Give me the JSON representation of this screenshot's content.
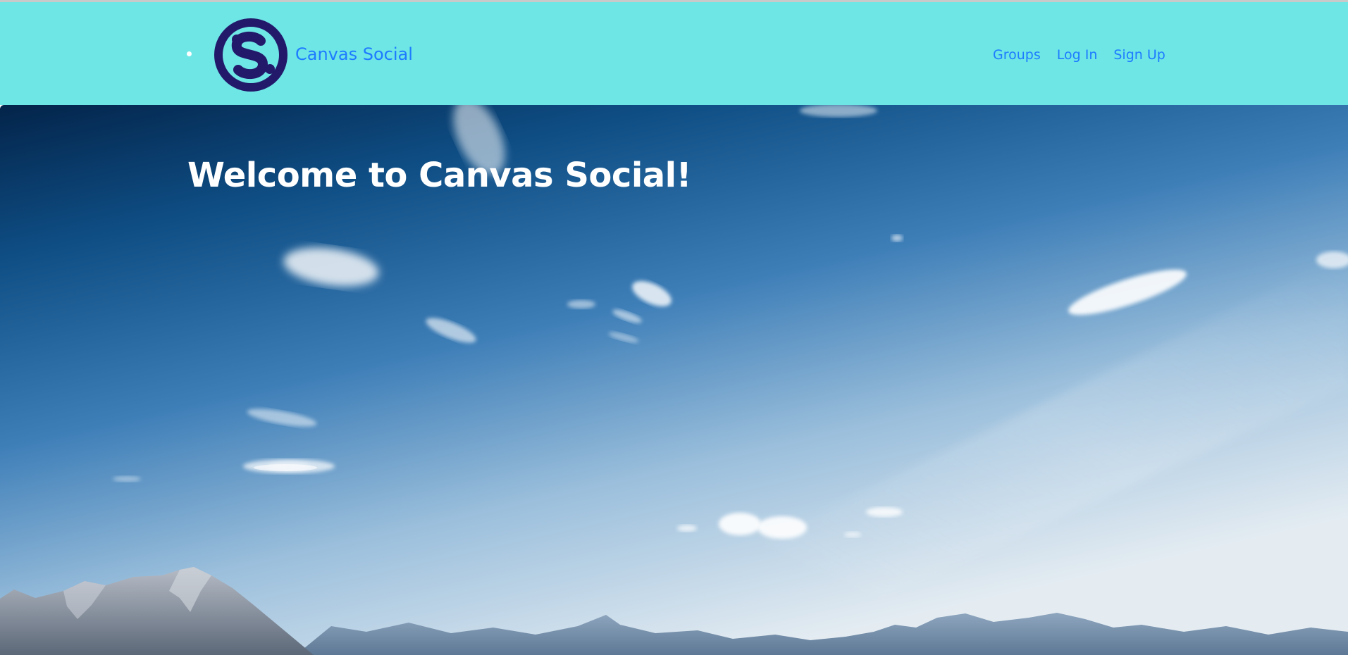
{
  "nav": {
    "brand": "Canvas Social",
    "links": {
      "groups": "Groups",
      "login": "Log In",
      "signup": "Sign Up"
    },
    "logo_icon": "canvas-social-s-logo"
  },
  "hero": {
    "title": "Welcome to Canvas Social!",
    "background": "sky-and-mountains"
  },
  "colors": {
    "navbar_bg": "#6ee6e6",
    "link": "#1e7bff",
    "logo": "#23196b",
    "hero_text": "#ffffff"
  }
}
